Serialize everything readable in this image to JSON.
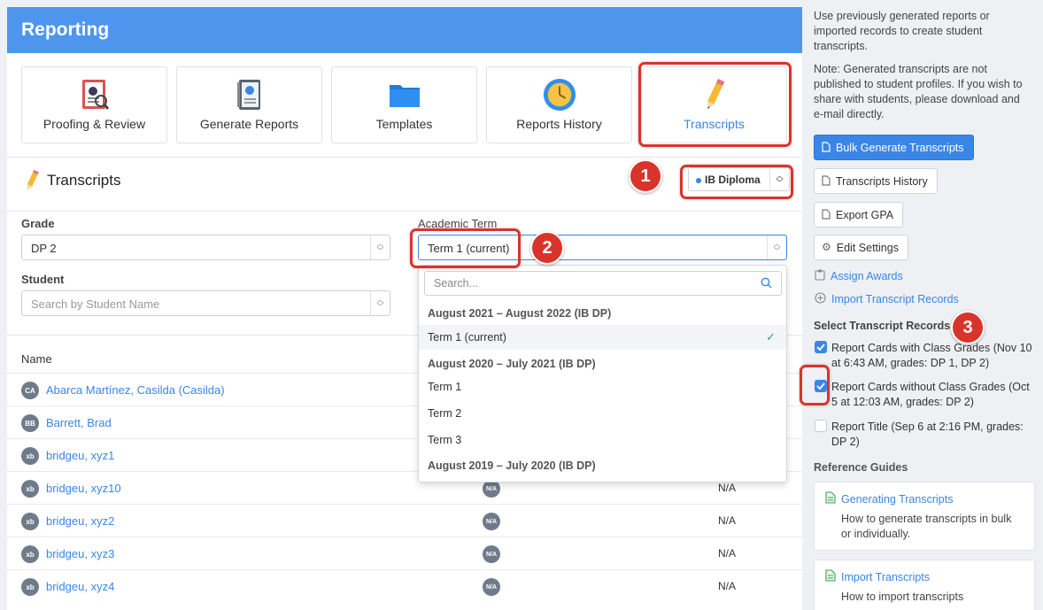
{
  "main": {
    "header_title": "Reporting",
    "tiles": [
      {
        "label": "Proofing & Review",
        "icon": "proofing-icon"
      },
      {
        "label": "Generate Reports",
        "icon": "report-cards-icon"
      },
      {
        "label": "Templates",
        "icon": "folder-icon"
      },
      {
        "label": "Reports History",
        "icon": "clock-icon"
      },
      {
        "label": "Transcripts",
        "icon": "pencil-icon",
        "active": true
      }
    ],
    "section_title": "Transcripts",
    "program_select": "IB Diploma",
    "grade_label": "Grade",
    "grade_value": "DP 2",
    "term_label": "Academic Term",
    "term_value": "Term 1 (current)",
    "student_label": "Student",
    "student_placeholder": "Search by Student Name",
    "column_name": "Name",
    "rows": [
      {
        "initials": "CA",
        "name": "Abarca Martínez, Casilda (Casilda)"
      },
      {
        "initials": "BB",
        "name": "Barrett, Brad"
      },
      {
        "initials": "xb",
        "name": "bridgeu, xyz1"
      },
      {
        "initials": "xb",
        "name": "bridgeu, xyz10",
        "badge": "N/A",
        "value": "N/A"
      },
      {
        "initials": "xb",
        "name": "bridgeu, xyz2",
        "badge": "N/A",
        "value": "N/A"
      },
      {
        "initials": "xb",
        "name": "bridgeu, xyz3",
        "badge": "N/A",
        "value": "N/A"
      },
      {
        "initials": "xb",
        "name": "bridgeu, xyz4",
        "badge": "N/A",
        "value": "N/A"
      }
    ]
  },
  "dropdown": {
    "search_placeholder": "Search...",
    "items": [
      {
        "label": "August 2021 – August 2022 (IB DP)",
        "type": "group"
      },
      {
        "label": "Term 1 (current)",
        "type": "option",
        "selected": true
      },
      {
        "label": "August 2020 – July 2021 (IB DP)",
        "type": "group"
      },
      {
        "label": "Term 1",
        "type": "option"
      },
      {
        "label": "Term 2",
        "type": "option"
      },
      {
        "label": "Term 3",
        "type": "option"
      },
      {
        "label": "August 2019 – July 2020 (IB DP)",
        "type": "group"
      }
    ]
  },
  "annotations": [
    "1",
    "2",
    "3"
  ],
  "sidebar": {
    "intro": "Use previously generated reports or imported records to create student transcripts.",
    "note": "Note: Generated transcripts are not published to student profiles. If you wish to share with students, please download and e-mail directly.",
    "bulk_button": "Bulk Generate Transcripts",
    "history_button": "Transcripts History",
    "export_button": "Export GPA",
    "settings_button": "Edit Settings",
    "assign_link": "Assign Awards",
    "import_link": "Import Transcript Records",
    "select_heading": "Select Transcript Records",
    "records": [
      {
        "label": "Report Cards with Class Grades (Nov 10 at 6:43 AM, grades: DP 1, DP 2)",
        "checked": true
      },
      {
        "label": "Report Cards without Class Grades (Oct 5 at 12:03 AM, grades: DP 2)",
        "checked": true
      },
      {
        "label": "Report Title (Sep 6 at 2:16 PM, grades: DP 2)",
        "checked": false
      }
    ],
    "guides_heading": "Reference Guides",
    "guides": [
      {
        "title": "Generating Transcripts",
        "desc": "How to generate transcripts in bulk or individually."
      },
      {
        "title": "Import Transcripts",
        "desc": "How to import transcripts"
      }
    ]
  },
  "colors": {
    "accent": "#3a86e6",
    "header": "#4e95ee",
    "annotation": "#d9342b"
  }
}
